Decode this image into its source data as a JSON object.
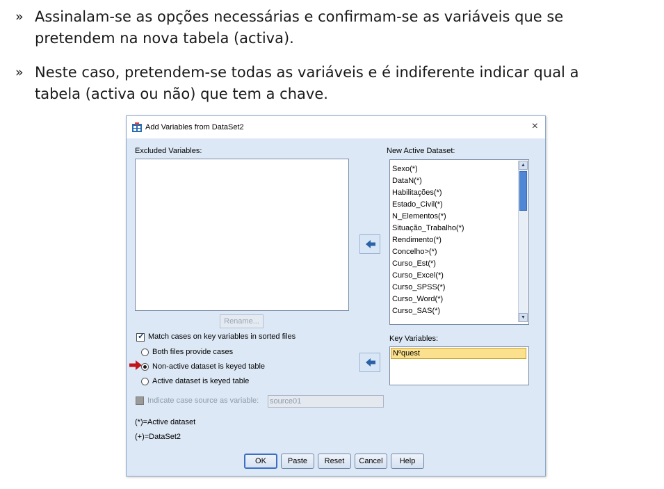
{
  "slide": {
    "bullet_mark": "»",
    "bullets": [
      [
        "Assinalam-se as opções necessárias e confirmam-se as variáveis que se",
        "pretendem na nova tabela (activa)."
      ],
      [
        "Neste caso, pretendem-se todas as variáveis e é indiferente indicar qual a",
        "tabela (activa ou não) que tem a chave."
      ]
    ]
  },
  "dialog": {
    "title": "Add Variables from DataSet2",
    "close_glyph": "×",
    "excluded_label": "Excluded Variables:",
    "new_active_label": "New Active Dataset:",
    "new_active_items": [
      "Sexo(*)",
      "DataN(*)",
      "Habilitações(*)",
      "Estado_Civil(*)",
      "N_Elementos(*)",
      "Situação_Trabalho(*)",
      "Rendimento(*)",
      "Concelho>(*)",
      "Curso_Est(*)",
      "Curso_Excel(*)",
      "Curso_SPSS(*)",
      "Curso_Word(*)",
      "Curso_SAS(*)"
    ],
    "rename_label": "Rename...",
    "key_variables_label": "Key Variables:",
    "key_variables_items": [
      "Nºquest"
    ],
    "match_cases_label": "Match cases on key variables in sorted files",
    "match_cases_checked": true,
    "radio_options": [
      "Both files provide cases",
      "Non-active dataset is keyed table",
      "Active dataset is keyed table"
    ],
    "radio_selected": 1,
    "indicate_label": "Indicate case source as variable:",
    "indicate_value": "source01",
    "legend_active": "(*)=Active dataset",
    "legend_dataset2": "(+)=DataSet2",
    "buttons": {
      "ok": "OK",
      "paste": "Paste",
      "reset": "Reset",
      "cancel": "Cancel",
      "help": "Help"
    }
  },
  "colors": {
    "dialog_bg": "#dde8f6",
    "key_highlight": "#fbe08e",
    "scroll_thumb": "#4f86d6",
    "red_arrow": "#c0141b"
  },
  "icons": [
    "app-icon",
    "close-icon",
    "move-left-arrow-icon",
    "red-pointer-arrow-icon"
  ]
}
